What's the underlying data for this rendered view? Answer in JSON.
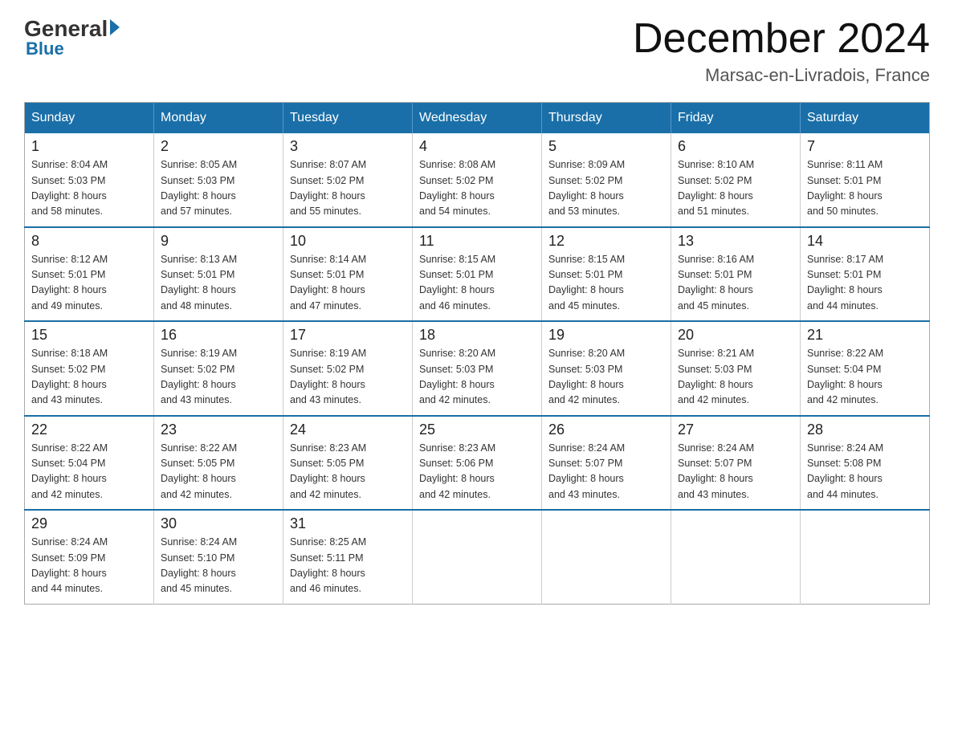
{
  "logo": {
    "general": "General",
    "blue": "Blue"
  },
  "header": {
    "month_year": "December 2024",
    "location": "Marsac-en-Livradois, France"
  },
  "days_of_week": [
    "Sunday",
    "Monday",
    "Tuesday",
    "Wednesday",
    "Thursday",
    "Friday",
    "Saturday"
  ],
  "weeks": [
    [
      {
        "day": "1",
        "sunrise": "8:04 AM",
        "sunset": "5:03 PM",
        "daylight": "8 hours and 58 minutes."
      },
      {
        "day": "2",
        "sunrise": "8:05 AM",
        "sunset": "5:03 PM",
        "daylight": "8 hours and 57 minutes."
      },
      {
        "day": "3",
        "sunrise": "8:07 AM",
        "sunset": "5:02 PM",
        "daylight": "8 hours and 55 minutes."
      },
      {
        "day": "4",
        "sunrise": "8:08 AM",
        "sunset": "5:02 PM",
        "daylight": "8 hours and 54 minutes."
      },
      {
        "day": "5",
        "sunrise": "8:09 AM",
        "sunset": "5:02 PM",
        "daylight": "8 hours and 53 minutes."
      },
      {
        "day": "6",
        "sunrise": "8:10 AM",
        "sunset": "5:02 PM",
        "daylight": "8 hours and 51 minutes."
      },
      {
        "day": "7",
        "sunrise": "8:11 AM",
        "sunset": "5:01 PM",
        "daylight": "8 hours and 50 minutes."
      }
    ],
    [
      {
        "day": "8",
        "sunrise": "8:12 AM",
        "sunset": "5:01 PM",
        "daylight": "8 hours and 49 minutes."
      },
      {
        "day": "9",
        "sunrise": "8:13 AM",
        "sunset": "5:01 PM",
        "daylight": "8 hours and 48 minutes."
      },
      {
        "day": "10",
        "sunrise": "8:14 AM",
        "sunset": "5:01 PM",
        "daylight": "8 hours and 47 minutes."
      },
      {
        "day": "11",
        "sunrise": "8:15 AM",
        "sunset": "5:01 PM",
        "daylight": "8 hours and 46 minutes."
      },
      {
        "day": "12",
        "sunrise": "8:15 AM",
        "sunset": "5:01 PM",
        "daylight": "8 hours and 45 minutes."
      },
      {
        "day": "13",
        "sunrise": "8:16 AM",
        "sunset": "5:01 PM",
        "daylight": "8 hours and 45 minutes."
      },
      {
        "day": "14",
        "sunrise": "8:17 AM",
        "sunset": "5:01 PM",
        "daylight": "8 hours and 44 minutes."
      }
    ],
    [
      {
        "day": "15",
        "sunrise": "8:18 AM",
        "sunset": "5:02 PM",
        "daylight": "8 hours and 43 minutes."
      },
      {
        "day": "16",
        "sunrise": "8:19 AM",
        "sunset": "5:02 PM",
        "daylight": "8 hours and 43 minutes."
      },
      {
        "day": "17",
        "sunrise": "8:19 AM",
        "sunset": "5:02 PM",
        "daylight": "8 hours and 43 minutes."
      },
      {
        "day": "18",
        "sunrise": "8:20 AM",
        "sunset": "5:03 PM",
        "daylight": "8 hours and 42 minutes."
      },
      {
        "day": "19",
        "sunrise": "8:20 AM",
        "sunset": "5:03 PM",
        "daylight": "8 hours and 42 minutes."
      },
      {
        "day": "20",
        "sunrise": "8:21 AM",
        "sunset": "5:03 PM",
        "daylight": "8 hours and 42 minutes."
      },
      {
        "day": "21",
        "sunrise": "8:22 AM",
        "sunset": "5:04 PM",
        "daylight": "8 hours and 42 minutes."
      }
    ],
    [
      {
        "day": "22",
        "sunrise": "8:22 AM",
        "sunset": "5:04 PM",
        "daylight": "8 hours and 42 minutes."
      },
      {
        "day": "23",
        "sunrise": "8:22 AM",
        "sunset": "5:05 PM",
        "daylight": "8 hours and 42 minutes."
      },
      {
        "day": "24",
        "sunrise": "8:23 AM",
        "sunset": "5:05 PM",
        "daylight": "8 hours and 42 minutes."
      },
      {
        "day": "25",
        "sunrise": "8:23 AM",
        "sunset": "5:06 PM",
        "daylight": "8 hours and 42 minutes."
      },
      {
        "day": "26",
        "sunrise": "8:24 AM",
        "sunset": "5:07 PM",
        "daylight": "8 hours and 43 minutes."
      },
      {
        "day": "27",
        "sunrise": "8:24 AM",
        "sunset": "5:07 PM",
        "daylight": "8 hours and 43 minutes."
      },
      {
        "day": "28",
        "sunrise": "8:24 AM",
        "sunset": "5:08 PM",
        "daylight": "8 hours and 44 minutes."
      }
    ],
    [
      {
        "day": "29",
        "sunrise": "8:24 AM",
        "sunset": "5:09 PM",
        "daylight": "8 hours and 44 minutes."
      },
      {
        "day": "30",
        "sunrise": "8:24 AM",
        "sunset": "5:10 PM",
        "daylight": "8 hours and 45 minutes."
      },
      {
        "day": "31",
        "sunrise": "8:25 AM",
        "sunset": "5:11 PM",
        "daylight": "8 hours and 46 minutes."
      },
      null,
      null,
      null,
      null
    ]
  ],
  "labels": {
    "sunrise": "Sunrise:",
    "sunset": "Sunset:",
    "daylight": "Daylight:"
  }
}
